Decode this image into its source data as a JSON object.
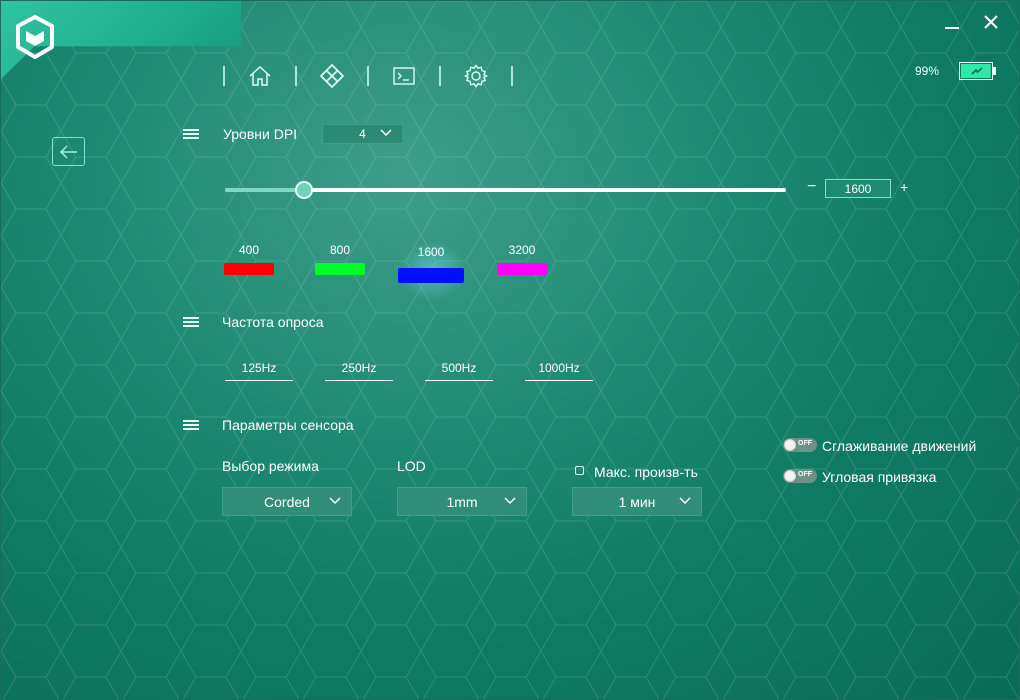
{
  "battery": {
    "percent_label": "99%",
    "level": 0.99,
    "color": "#2ee8a8"
  },
  "nav": {
    "items": [
      "home-icon",
      "lighting-icon",
      "macro-icon",
      "settings-icon"
    ]
  },
  "dpi": {
    "title": "Уровни DPI",
    "levels_count": "4",
    "current_value": "1600",
    "slider_fraction": 0.14,
    "minus_label": "−",
    "plus_label": "+",
    "levels": [
      {
        "label": "400",
        "color": "#ff0000"
      },
      {
        "label": "800",
        "color": "#00ff2a"
      },
      {
        "label": "1600",
        "color": "#0010ff"
      },
      {
        "label": "3200",
        "color": "#ff00ff"
      }
    ],
    "active_index": 2
  },
  "polling": {
    "title": "Частота опроса",
    "rates": [
      "125Hz",
      "250Hz",
      "500Hz",
      "1000Hz"
    ],
    "active_index": 3
  },
  "sensor": {
    "title": "Параметры сенсора",
    "mode_label": "Выбор режима",
    "mode_value": "Corded",
    "lod_label": "LOD",
    "lod_value": "1mm",
    "max_perf_label": "Макс. произв-ть",
    "max_perf_value": "1 мин",
    "smoothing_label": "Сглаживание движений",
    "angle_snap_label": "Угловая привязка",
    "toggle_off_text": "OFF"
  }
}
